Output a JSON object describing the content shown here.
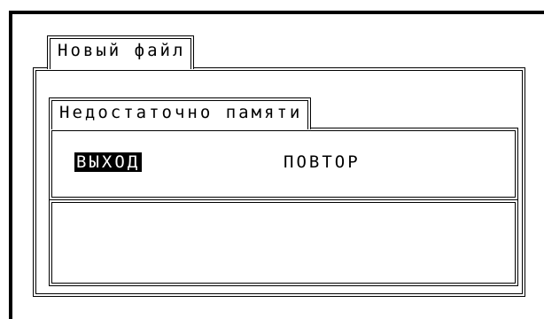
{
  "window": {
    "title": "Новый файл"
  },
  "dialog": {
    "title": "Недостаточно памяти",
    "options": [
      {
        "label": "ВЫХОД",
        "selected": true
      },
      {
        "label": "ПОВТОР",
        "selected": false
      }
    ]
  }
}
